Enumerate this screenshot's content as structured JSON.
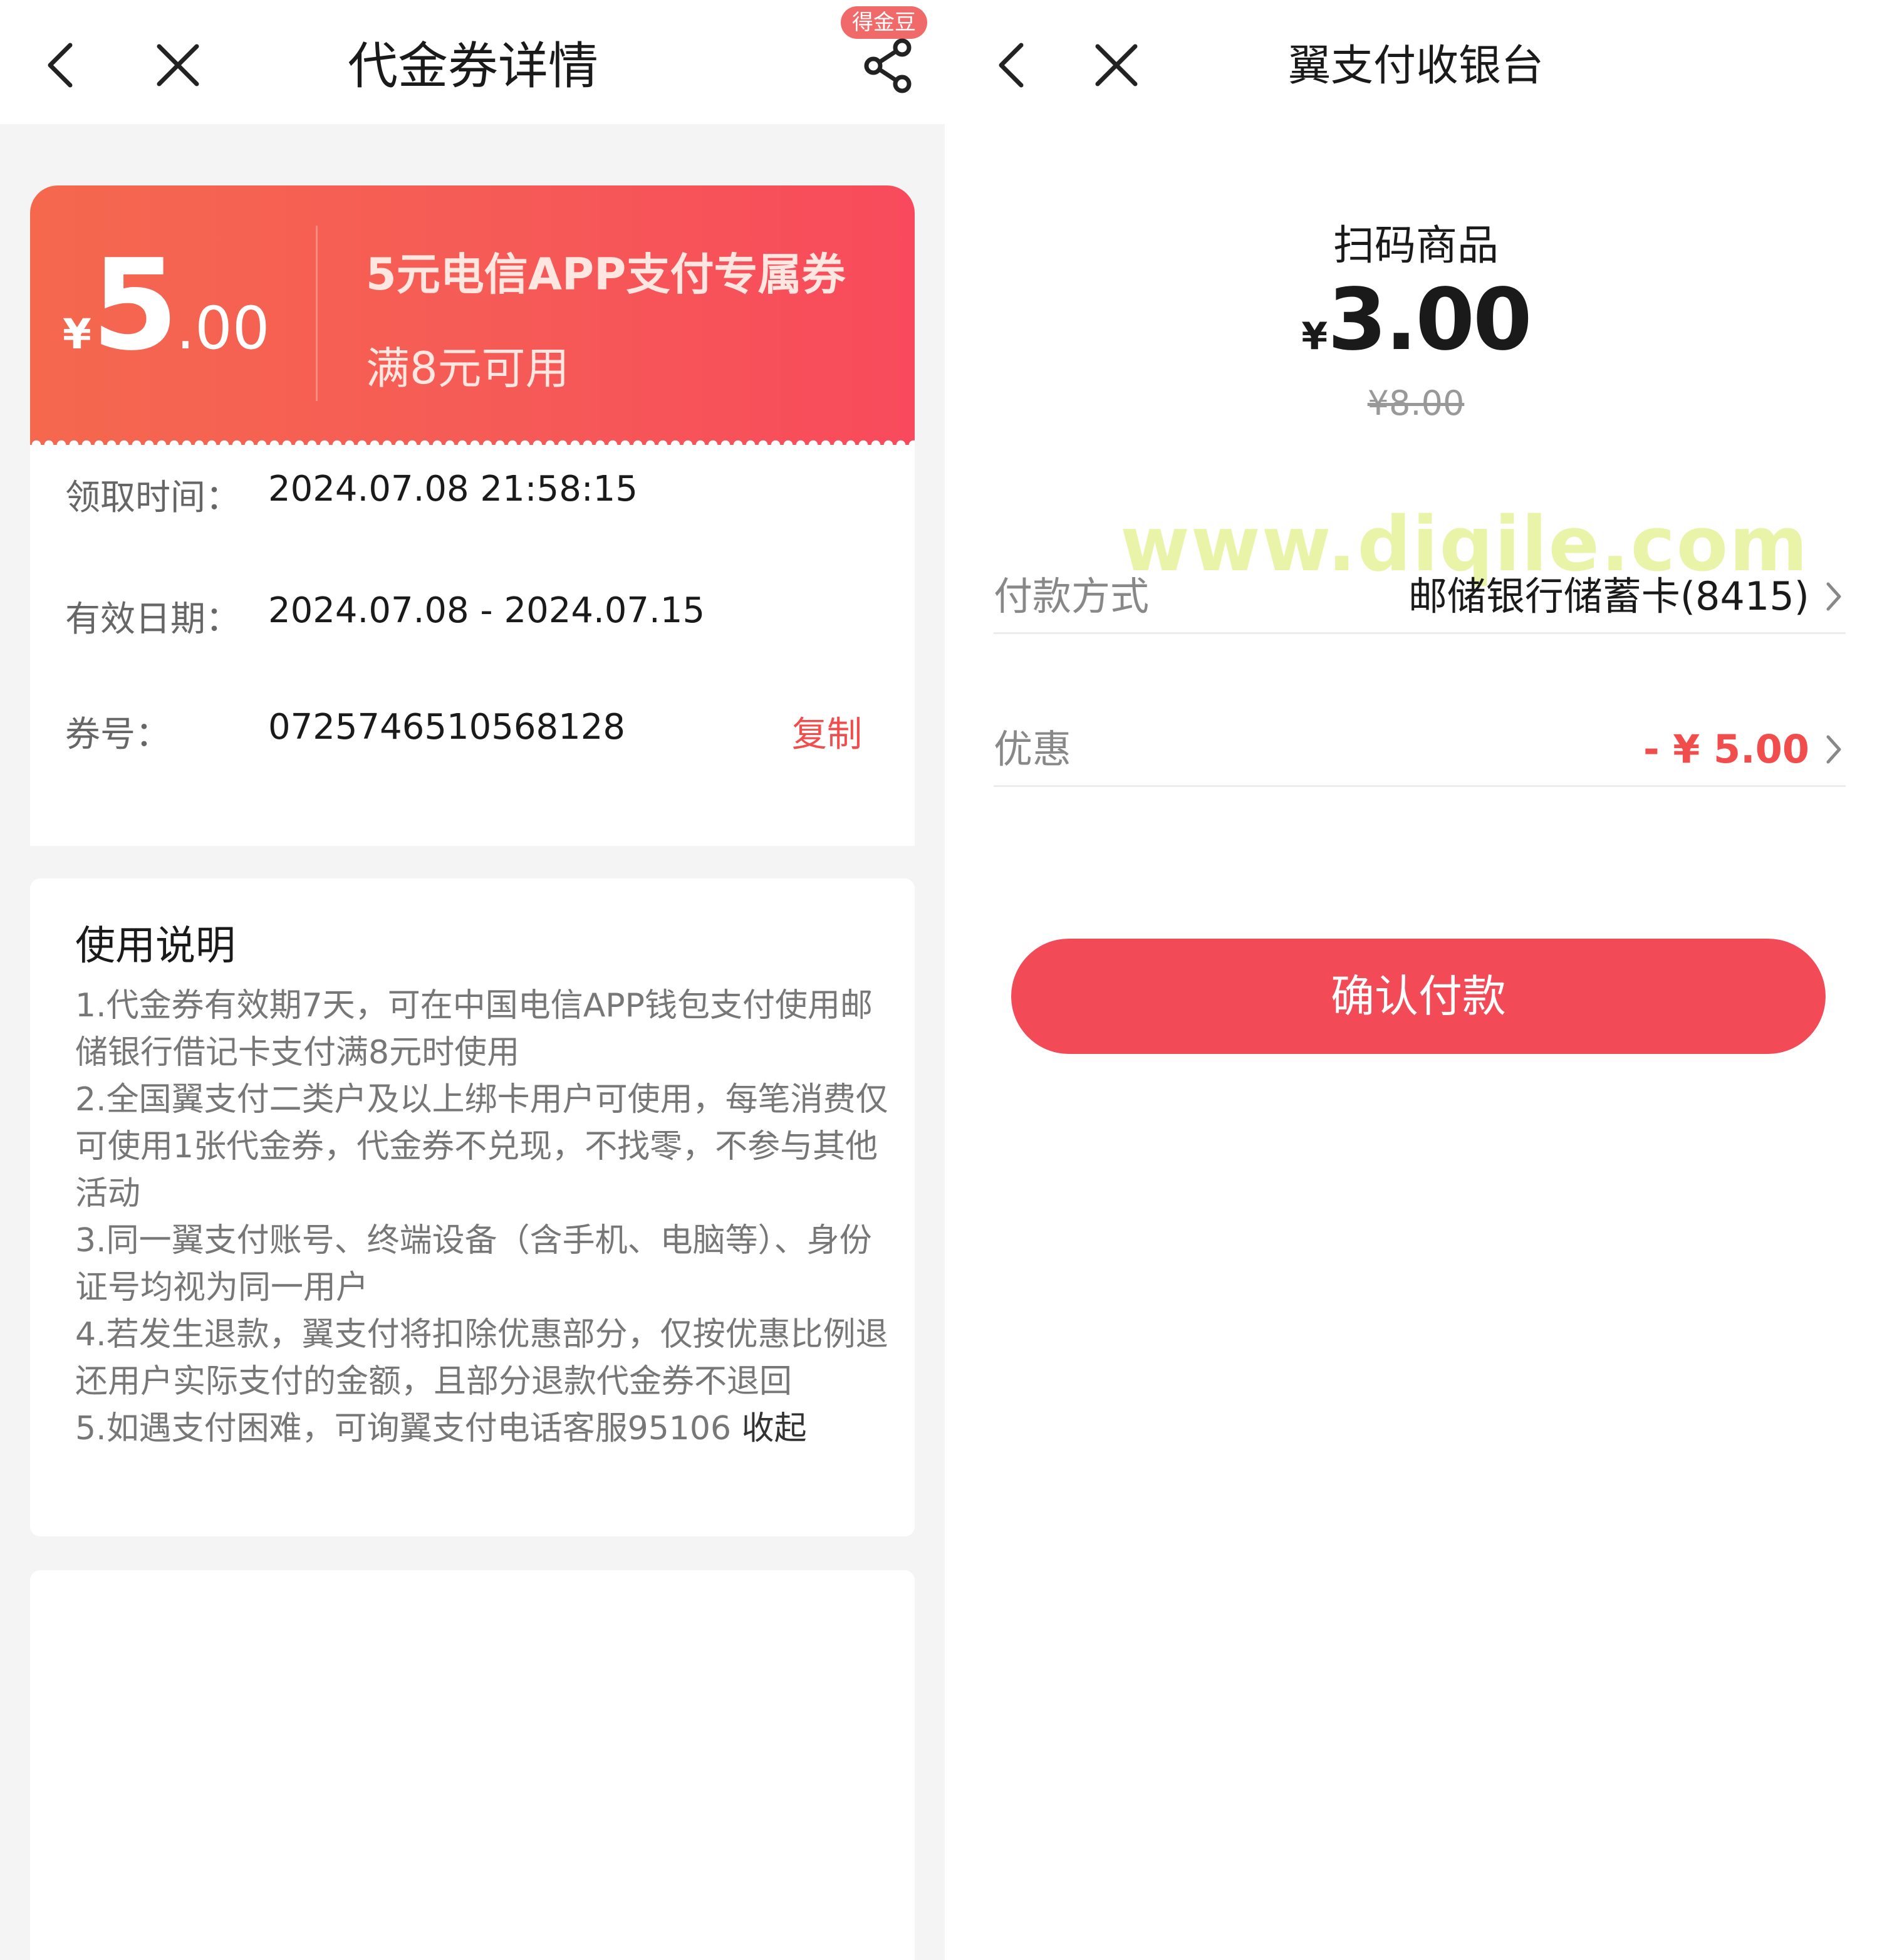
{
  "left": {
    "nav": {
      "title": "代金券详情",
      "badge": "得金豆"
    },
    "coupon": {
      "currency": "¥",
      "amount_int": "5",
      "amount_dec": ".00",
      "title": "5元电信APP支付专属券",
      "condition": "满8元可用"
    },
    "info": {
      "claim_label": "领取时间：",
      "claim_value": "2024.07.08 21:58:15",
      "valid_label": "有效日期：",
      "valid_value": "2024.07.08 - 2024.07.15",
      "code_label": "券号：",
      "code_value": "0725746510568128",
      "copy_label": "复制"
    },
    "usage": {
      "title": "使用说明",
      "items": [
        "1.代金券有效期7天，可在中国电信APP钱包支付使用邮储银行借记卡支付满8元时使用",
        "2.全国翼支付二类户及以上绑卡用户可使用，每笔消费仅可使用1张代金券，代金券不兑现，不找零，不参与其他活动",
        "3.同一翼支付账号、终端设备（含手机、电脑等）、身份证号均视为同一用户",
        "4.若发生退款，翼支付将扣除优惠部分，仅按优惠比例退还用户实际支付的金额，且部分退款代金券不退回",
        "5.如遇支付困难，可询翼支付电话客服95106 "
      ],
      "collapse_label": "收起"
    }
  },
  "right": {
    "nav": {
      "title": "翼支付收银台"
    },
    "product_name": "扫码商品",
    "price_symbol": "¥",
    "price": "3.00",
    "original_price": "¥8.00",
    "watermark": "www.diqile.com",
    "payment_method": {
      "label": "付款方式",
      "value": "邮储银行储蓄卡(8415)"
    },
    "discount": {
      "label": "优惠",
      "value": "- ¥ 5.00"
    },
    "confirm_label": "确认付款"
  },
  "colors": {
    "accent_red": "#f24a57",
    "coupon_gradient_start": "#f5684e",
    "coupon_gradient_end": "#f84a5c"
  },
  "icons": [
    "back-icon",
    "close-icon",
    "share-icon",
    "chevron-right-icon"
  ]
}
